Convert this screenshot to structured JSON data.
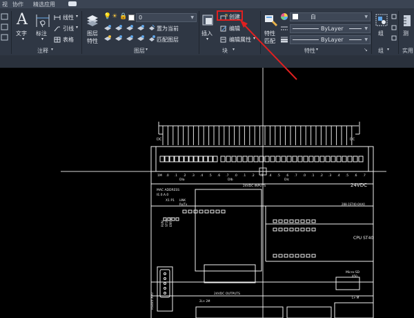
{
  "menu": {
    "tabs": [
      "视",
      "协作",
      "精选应用"
    ]
  },
  "ribbon": {
    "annotation": {
      "title": "注释",
      "text_label": "文字",
      "dimension_label": "标注",
      "linear_label": "线性",
      "leader_label": "引线",
      "table_label": "表格"
    },
    "layers": {
      "title": "图层",
      "layer_props_label1": "图层",
      "layer_props_label2": "特性",
      "current_layer": "0",
      "make_current_label": "置为当前",
      "match_layer_label": "匹配图层"
    },
    "block": {
      "title": "块",
      "insert_label": "插入",
      "create_label": "创建",
      "edit_label": "编辑",
      "edit_attr_label": "编辑属性"
    },
    "properties": {
      "title": "特性",
      "match_label1": "特性",
      "match_label2": "匹配",
      "color_value": "白",
      "linetype_value": "ByLayer",
      "lineweight_value": "ByLayer"
    },
    "groups": {
      "title": "组",
      "group_label": "组"
    },
    "utilities": {
      "measure_label": "测",
      "title": "实用"
    }
  },
  "colors": {
    "ribbon_bg": "#2f3744",
    "highlight_box": "#e02020",
    "arrow": "#e02020",
    "canvas_bg": "#000000",
    "drawing_lines": "#f2f2f2"
  },
  "drawing": {
    "dc_label": "DC",
    "top_labels": [
      "1M",
      ".0",
      ".1",
      ".2",
      ".3",
      ".4",
      ".5",
      ".6",
      ".7",
      ".0",
      ".1",
      ".2",
      ".3",
      ".4",
      ".5",
      ".6",
      ".7",
      ".0",
      ".1",
      ".2",
      ".3",
      ".4",
      ".5",
      ".6",
      ".7"
    ],
    "dia_label": "DIa",
    "dib_label": "DIb",
    "dic_label": "DIc",
    "input_label": "24VDC INPUTS",
    "voltage_label": "24VDC",
    "mac_label": "MAC ADDRESS",
    "mac_value": "IE.0.A.0",
    "x1_label": "X1 P1",
    "link_label": "LINK",
    "rxtx_label": "Rx/Tx",
    "model_label": "288-1ST40-0AA0",
    "cpu_label": "CPU ST40",
    "microsd_label": "Micro-SD",
    "x50_label": "X50",
    "rs485_label": "RS485 X20",
    "output_label": "24VDC OUTPUTS",
    "io_labels": [
      ".0",
      ".1",
      ".2",
      ".3",
      ".4",
      ".5",
      ".6",
      ".7",
      "DQa"
    ],
    "status_labels": [
      "RUN",
      "STOP",
      "ERROR"
    ],
    "bottom_left": "2L+ 2M",
    "bottom_right": "L+ M"
  }
}
